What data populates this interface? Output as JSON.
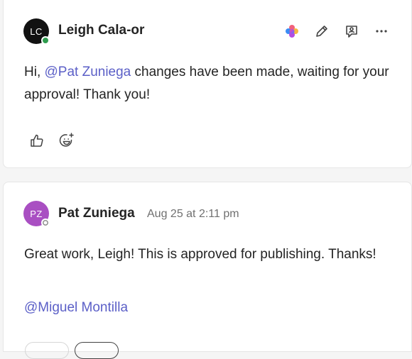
{
  "messages": [
    {
      "author": "Leigh Cala-or",
      "initials": "LC",
      "avatar_color": "#111111",
      "presence": "available",
      "presence_color": "#2e9c4e",
      "text_prefix": "Hi, ",
      "mention": "@Pat Zuniega",
      "text_rest": " changes have been made, waiting for your approval! Thank you!",
      "actions": [
        "copilot-icon",
        "edit-icon",
        "feedback-icon",
        "more-icon"
      ],
      "reactions": [
        "thumbs-up-icon",
        "add-emoji-icon"
      ]
    },
    {
      "author": "Pat Zuniega",
      "initials": "PZ",
      "avatar_color": "#a94fc2",
      "presence": "offline",
      "presence_color": "#8a8a8a",
      "timestamp": "Aug 25 at 2:11 pm",
      "text": "Great work, Leigh! This is approved for publishing. Thanks!",
      "mention": "@Miguel Montilla"
    }
  ]
}
